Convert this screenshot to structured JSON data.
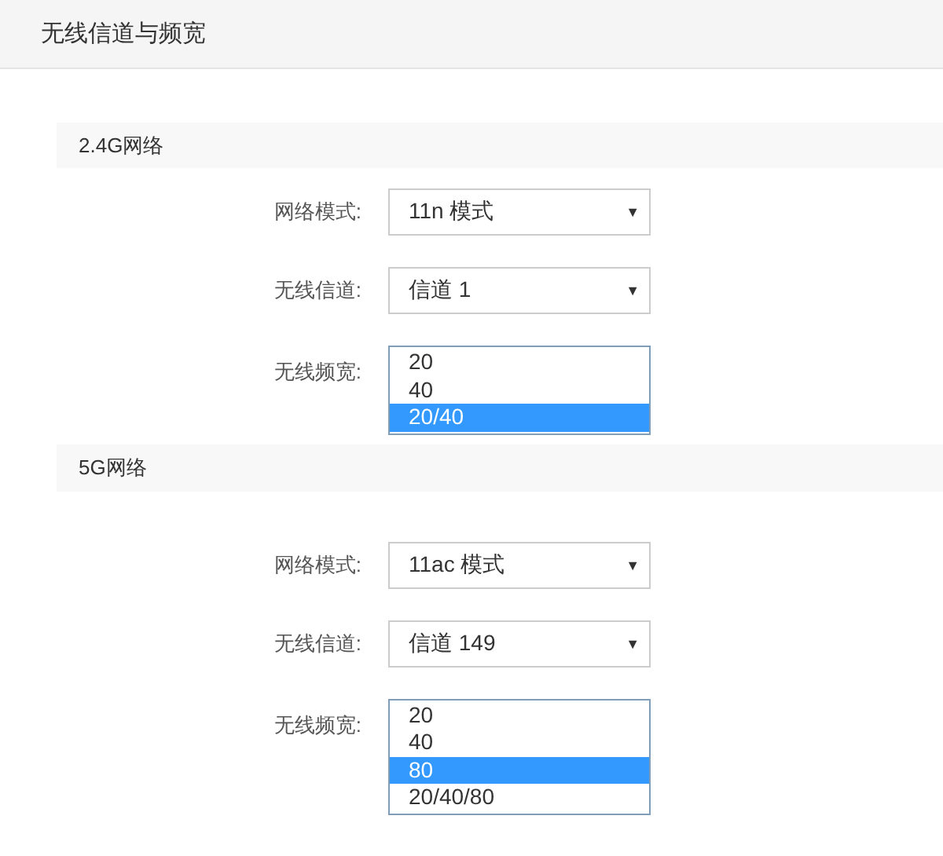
{
  "page_title": "无线信道与频宽",
  "sections": [
    {
      "title": "2.4G网络",
      "fields": [
        {
          "kind": "dropdown",
          "label": "网络模式:",
          "value": "11n 模式",
          "arrow": "▼"
        },
        {
          "kind": "dropdown",
          "label": "无线信道:",
          "value": "信道 1",
          "arrow": "▼"
        },
        {
          "kind": "listbox",
          "label": "无线频宽:",
          "options": [
            {
              "text": "20",
              "selected": false
            },
            {
              "text": "40",
              "selected": false
            },
            {
              "text": "20/40",
              "selected": true
            }
          ]
        }
      ]
    },
    {
      "title": "5G网络",
      "fields": [
        {
          "kind": "dropdown",
          "label": "网络模式:",
          "value": "11ac 模式",
          "arrow": "▼"
        },
        {
          "kind": "dropdown",
          "label": "无线信道:",
          "value": "信道 149",
          "arrow": "▼"
        },
        {
          "kind": "listbox",
          "label": "无线频宽:",
          "options": [
            {
              "text": "20",
              "selected": false
            },
            {
              "text": "40",
              "selected": false
            },
            {
              "text": "80",
              "selected": true
            },
            {
              "text": "20/40/80",
              "selected": false
            }
          ]
        }
      ]
    }
  ]
}
